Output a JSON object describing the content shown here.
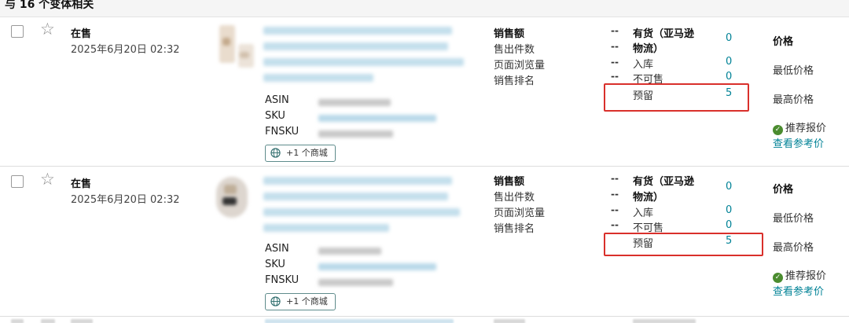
{
  "header": {
    "text": "与 16 个变体相关"
  },
  "rows": [
    {
      "status": "在售",
      "date": "2025年6月20日 02:32",
      "id_labels": {
        "asin": "ASIN",
        "sku": "SKU",
        "fnsku": "FNSKU"
      },
      "marketplace_button": "+1 个商城",
      "metrics": {
        "sales": "销售额",
        "units": "售出件数",
        "page_views": "页面浏览量",
        "rank": "销售排名"
      },
      "inventory": {
        "dashes": [
          "--",
          "--",
          "--",
          "--"
        ],
        "available_line1": "有货（亚马逊",
        "available_line2": "物流）",
        "available_value": "0",
        "inbound": "入库",
        "inbound_value": "0",
        "unfulfillable": "不可售",
        "unfulfillable_value": "0",
        "reserved": "预留",
        "reserved_value": "5"
      },
      "price": {
        "title": "价格",
        "min": "最低价格",
        "max": "最高价格",
        "recommended": "推荐报价",
        "view_reference": "查看参考价"
      }
    },
    {
      "status": "在售",
      "date": "2025年6月20日 02:32",
      "id_labels": {
        "asin": "ASIN",
        "sku": "SKU",
        "fnsku": "FNSKU"
      },
      "marketplace_button": "+1 个商城",
      "metrics": {
        "sales": "销售额",
        "units": "售出件数",
        "page_views": "页面浏览量",
        "rank": "销售排名"
      },
      "inventory": {
        "dashes": [
          "--",
          "--",
          "--",
          "--"
        ],
        "available_line1": "有货（亚马逊",
        "available_line2": "物流）",
        "available_value": "0",
        "inbound": "入库",
        "inbound_value": "0",
        "unfulfillable": "不可售",
        "unfulfillable_value": "0",
        "reserved": "预留",
        "reserved_value": "5"
      },
      "price": {
        "title": "价格",
        "min": "最低价格",
        "max": "最高价格",
        "recommended": "推荐报价",
        "view_reference": "查看参考价"
      }
    }
  ],
  "icons": {
    "checkbox": "checkbox-icon",
    "star": "star-icon",
    "globe": "globe-icon",
    "check": "check-circle-icon"
  },
  "colors": {
    "link": "#008296",
    "highlight_box": "#d9302b",
    "check": "#4b8c2f"
  }
}
